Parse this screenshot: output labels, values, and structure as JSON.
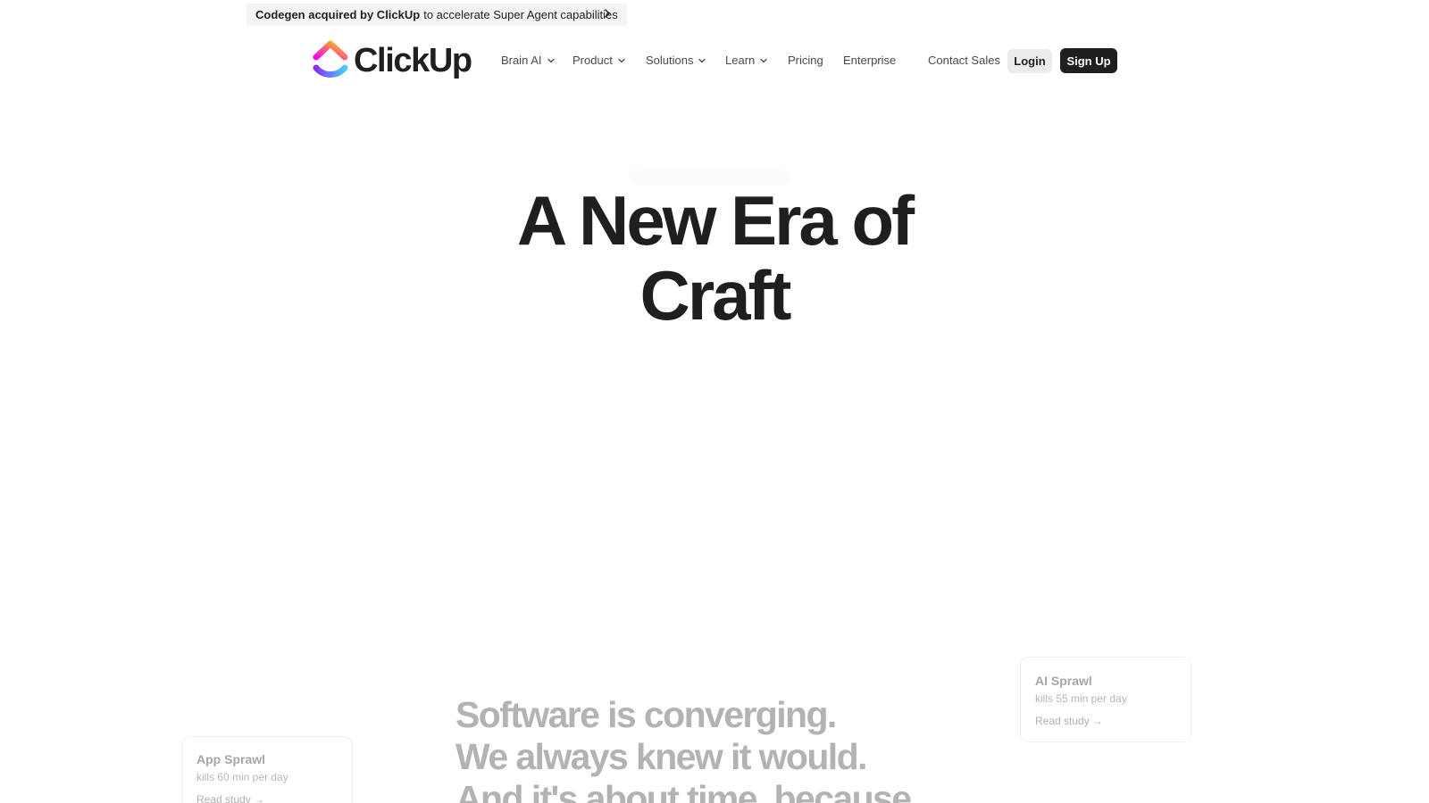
{
  "announcement": {
    "bold_text": "Codegen acquired by ClickUp",
    "text": "to accelerate Super Agent capabilities",
    "icon": "chevron-right-icon"
  },
  "brand": {
    "name": "ClickUp",
    "logo_colors": [
      "#ff02f0",
      "#ffc800",
      "#8930fd",
      "#49ccf9"
    ]
  },
  "nav": {
    "items": [
      {
        "label": "Brain AI",
        "has_dropdown": true
      },
      {
        "label": "Product",
        "has_dropdown": true
      },
      {
        "label": "Solutions",
        "has_dropdown": true
      },
      {
        "label": "Learn",
        "has_dropdown": true
      },
      {
        "label": "Pricing",
        "has_dropdown": false
      },
      {
        "label": "Enterprise",
        "has_dropdown": false
      }
    ],
    "contact_sales": "Contact Sales",
    "login": "Login",
    "signup": "Sign Up"
  },
  "hero": {
    "title_line1": "A New Era of",
    "title_line2": "Craft"
  },
  "cards": {
    "ai_sprawl": {
      "title": "AI Sprawl",
      "subtitle": "kills 55 min per day",
      "link": "Read study →"
    },
    "app_sprawl": {
      "title": "App Sprawl",
      "subtitle": "kills 60 min per day",
      "link": "Read study →"
    }
  },
  "converging": {
    "line1": "Software is converging.",
    "line2": "We always knew it would.",
    "line3": "And it's about time, because"
  }
}
